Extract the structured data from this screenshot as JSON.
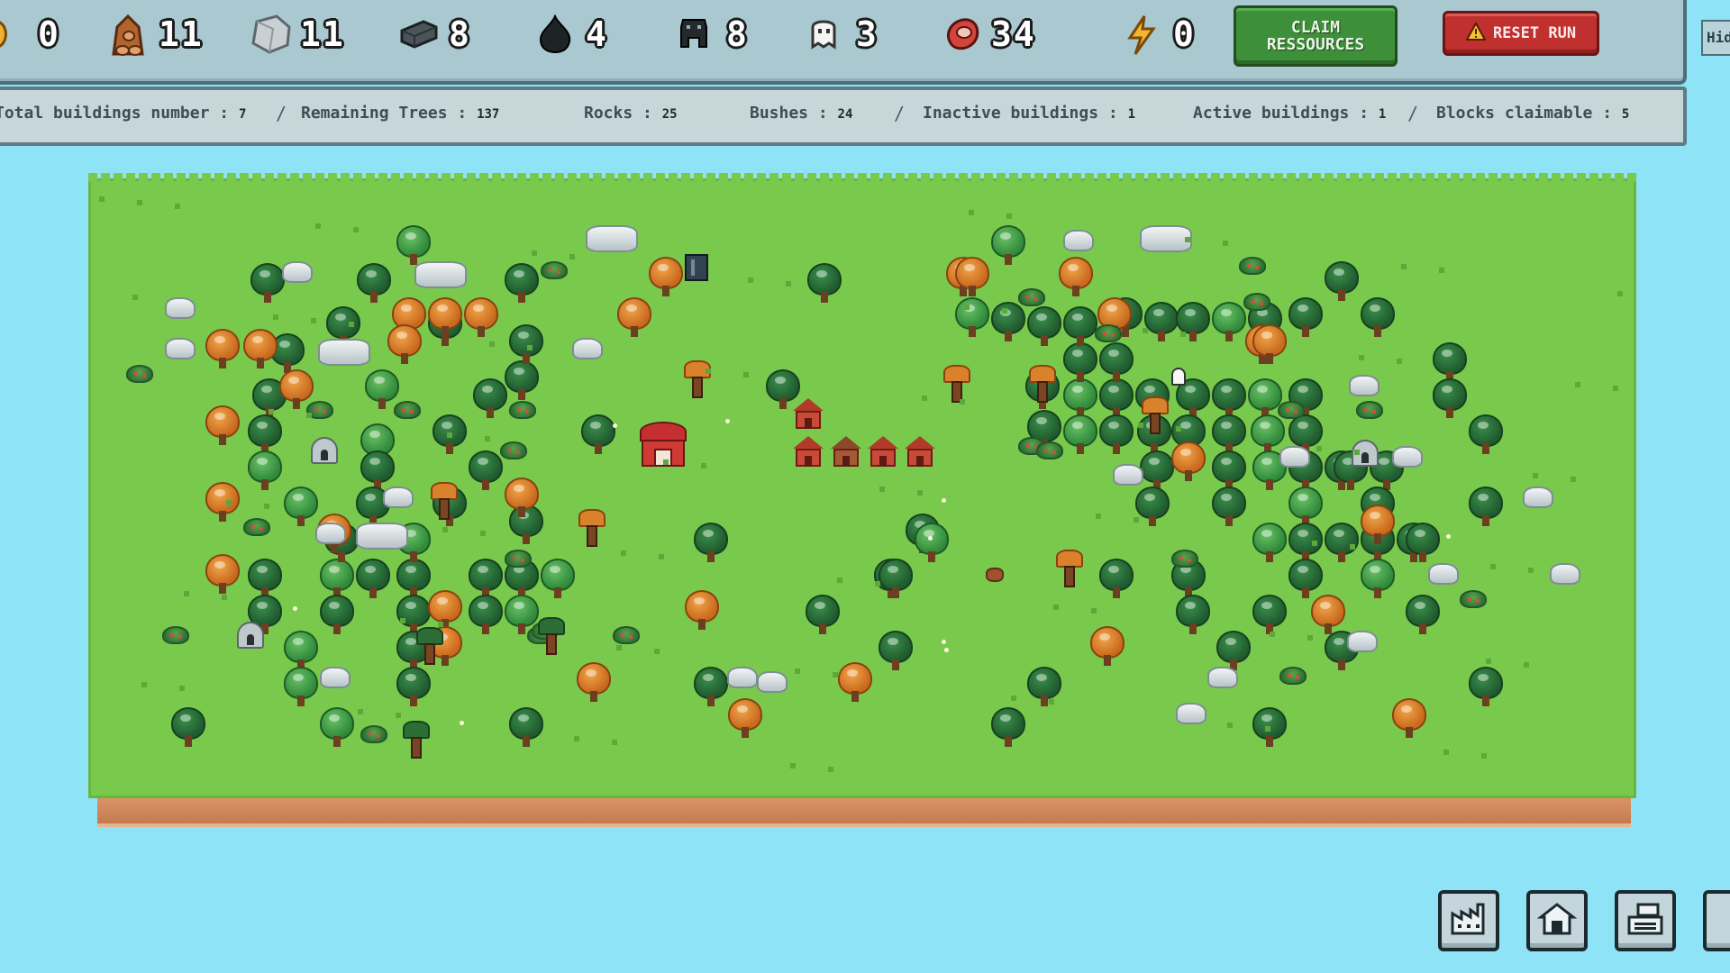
{
  "resources": [
    {
      "name": "coin-icon",
      "value": "0"
    },
    {
      "name": "wood-icon",
      "value": "11"
    },
    {
      "name": "stone-icon",
      "value": "11"
    },
    {
      "name": "iron-icon",
      "value": "8"
    },
    {
      "name": "coal-icon",
      "value": "4"
    },
    {
      "name": "worker-icon",
      "value": "8"
    },
    {
      "name": "ghost-icon",
      "value": "3"
    },
    {
      "name": "meat-icon",
      "value": "34"
    },
    {
      "name": "energy-icon",
      "value": "0"
    }
  ],
  "buttons": {
    "claim_line1": "CLAIM",
    "claim_line2": "RESSOURCES",
    "reset": "RESET RUN",
    "hide": "Hid"
  },
  "stats": {
    "total_label": "Total buildings number :",
    "total": "7",
    "trees_label": "Remaining Trees :",
    "trees": "137",
    "rocks_label": "Rocks :",
    "rocks": "25",
    "bushes_label": "Bushes :",
    "bushes": "24",
    "inactive_label": "Inactive buildings :",
    "inactive": "1",
    "active_label": "Active buildings :",
    "active": "1",
    "claimable_label": "Blocks claimable :",
    "claimable": "5"
  },
  "colors": {
    "sky": "#8fe3f7",
    "grass": "#79c94d",
    "dirt": "#c47a4f",
    "claim_button": "#3e8f3a",
    "reset_button": "#c0302e"
  },
  "bottom_buttons": [
    "factory-icon",
    "house-icon",
    "register-icon",
    "extra-icon"
  ]
}
